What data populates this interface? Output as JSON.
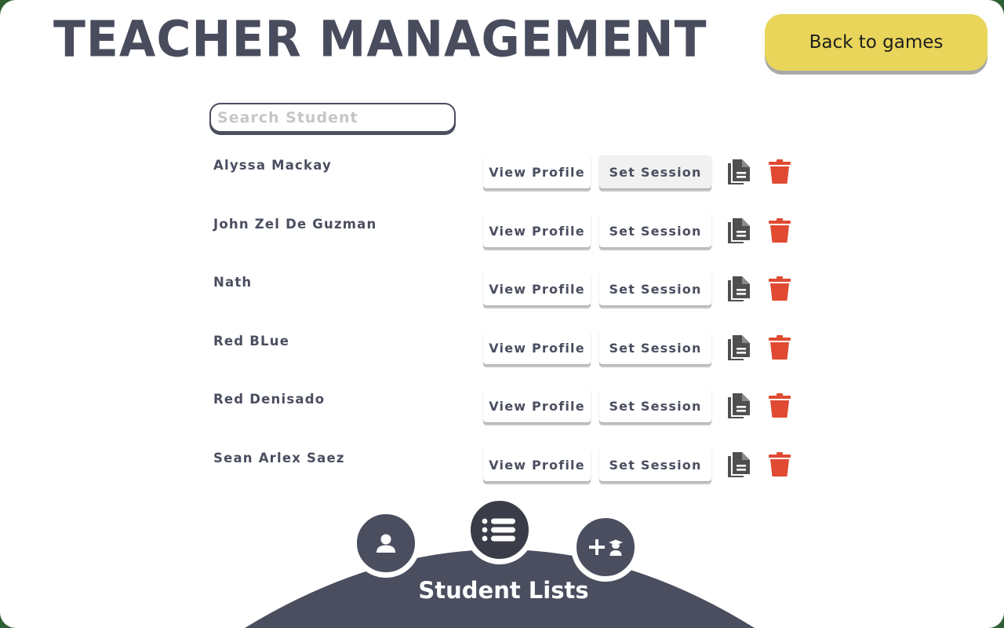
{
  "header": {
    "title": "TEACHER MANAGEMENT",
    "back_label": "Back to games"
  },
  "search": {
    "placeholder": "Search Student",
    "value": ""
  },
  "students": [
    {
      "name": "Alyssa Mackay"
    },
    {
      "name": "John Zel De Guzman"
    },
    {
      "name": "Nath"
    },
    {
      "name": "Red BLue"
    },
    {
      "name": "Red Denisado"
    },
    {
      "name": "Sean Arlex Saez"
    }
  ],
  "row_actions": {
    "view_profile": "View Profile",
    "set_session": "Set Session",
    "report_icon": "document-icon",
    "delete_icon": "trash-icon"
  },
  "bottom_nav": {
    "active_label": "Student Lists",
    "items": [
      {
        "icon": "user-icon"
      },
      {
        "icon": "list-icon"
      },
      {
        "icon": "add-student-icon"
      }
    ]
  },
  "colors": {
    "primary_dark": "#4a4e5f",
    "accent_yellow": "#e8d55a",
    "delete_red": "#e04a32",
    "icon_gray": "#4f4f4f"
  }
}
